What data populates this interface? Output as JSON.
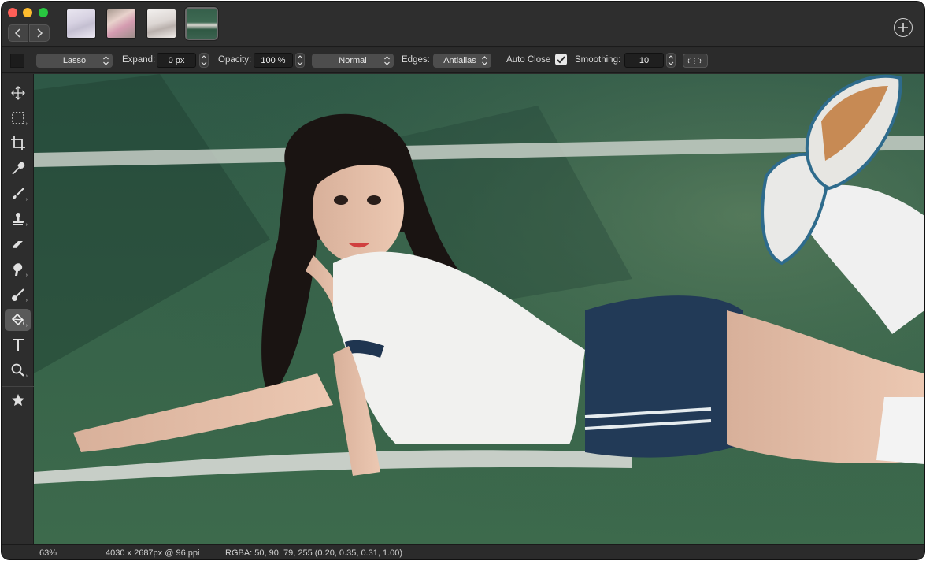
{
  "titlebar": {
    "tabs": [
      {
        "name": "image-1"
      },
      {
        "name": "image-2"
      },
      {
        "name": "image-3"
      },
      {
        "name": "image-4",
        "active": true
      }
    ],
    "new_tab_icon": "plus-circle-icon",
    "back_icon": "chevron-left-icon",
    "forward_icon": "chevron-right-icon"
  },
  "options": {
    "tool_select": "Lasso",
    "expand_label": "Expand:",
    "expand_value": "0 px",
    "opacity_label": "Opacity:",
    "opacity_value": "100 %",
    "blend_mode": "Normal",
    "edges_label": "Edges:",
    "edges_value": "Antialias",
    "auto_close_label": "Auto Close",
    "auto_close_checked": true,
    "smoothing_label": "Smoothing:",
    "smoothing_value": "10"
  },
  "tools": [
    {
      "name": "move-icon"
    },
    {
      "name": "marquee-icon"
    },
    {
      "name": "crop-icon"
    },
    {
      "name": "eyedropper-icon"
    },
    {
      "name": "brush-icon"
    },
    {
      "name": "clone-stamp-icon"
    },
    {
      "name": "eraser-icon"
    },
    {
      "name": "smudge-icon"
    },
    {
      "name": "retouch-icon"
    },
    {
      "name": "paint-bucket-icon",
      "active": true
    },
    {
      "name": "text-icon"
    },
    {
      "name": "zoom-icon"
    },
    {
      "name": "favorites-star-icon"
    }
  ],
  "status": {
    "zoom": "63%",
    "dimensions": "4030 x 2687px @ 96 ppi",
    "color": "RGBA: 50, 90, 79, 255 (0.20, 0.35, 0.31, 1.00)"
  },
  "colors": {
    "chrome": "#2a2a2a",
    "turf": "#2f5843",
    "accent_red": "#fe5f57",
    "accent_yellow": "#febc2e",
    "accent_green": "#28c840"
  }
}
